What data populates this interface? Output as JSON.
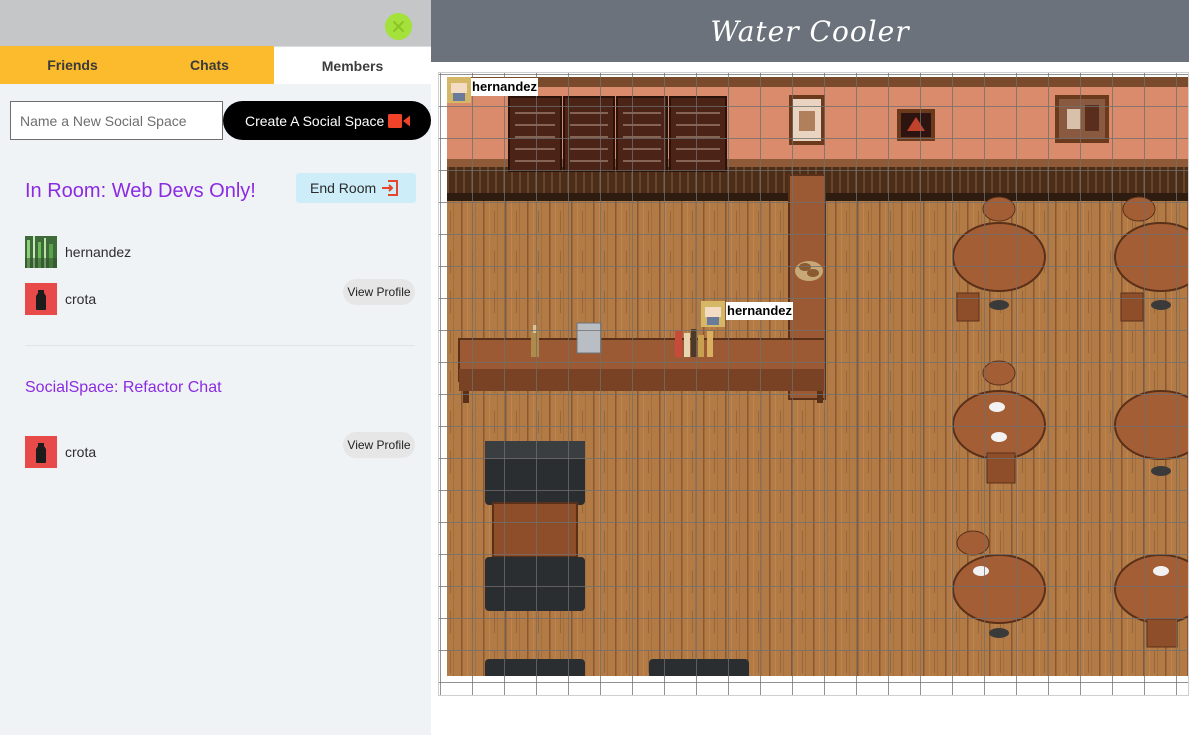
{
  "sidebar": {
    "tabs": [
      {
        "label": "Friends"
      },
      {
        "label": "Chats"
      },
      {
        "label": "Members"
      }
    ],
    "new_space": {
      "placeholder": "Name a New Social Space",
      "value": "",
      "create_label": "Create A Social Space"
    },
    "room": {
      "title": "In Room: Web Devs Only!",
      "end_label": "End Room",
      "members": [
        {
          "name": "hernandez"
        },
        {
          "name": "crota",
          "action": "View Profile"
        }
      ]
    },
    "social_space": {
      "title": "SocialSpace: Refactor Chat",
      "members": [
        {
          "name": "crota",
          "action": "View Profile"
        }
      ]
    }
  },
  "game": {
    "title": "Water Cooler",
    "players": [
      {
        "name": "hernandez"
      },
      {
        "name": "hernandez"
      }
    ]
  },
  "colors": {
    "tab_yellow": "#fbbb2c",
    "close_button": "#a4e13a",
    "accent_purple": "#8a2be2",
    "end_room_bg": "#cdeef9",
    "header_gray": "#6b727b",
    "avatar_red": "#e84a4a"
  },
  "icons": [
    "close-icon",
    "video-camera-icon",
    "exit-door-icon",
    "bottle-icon",
    "plant-photo-avatar"
  ]
}
